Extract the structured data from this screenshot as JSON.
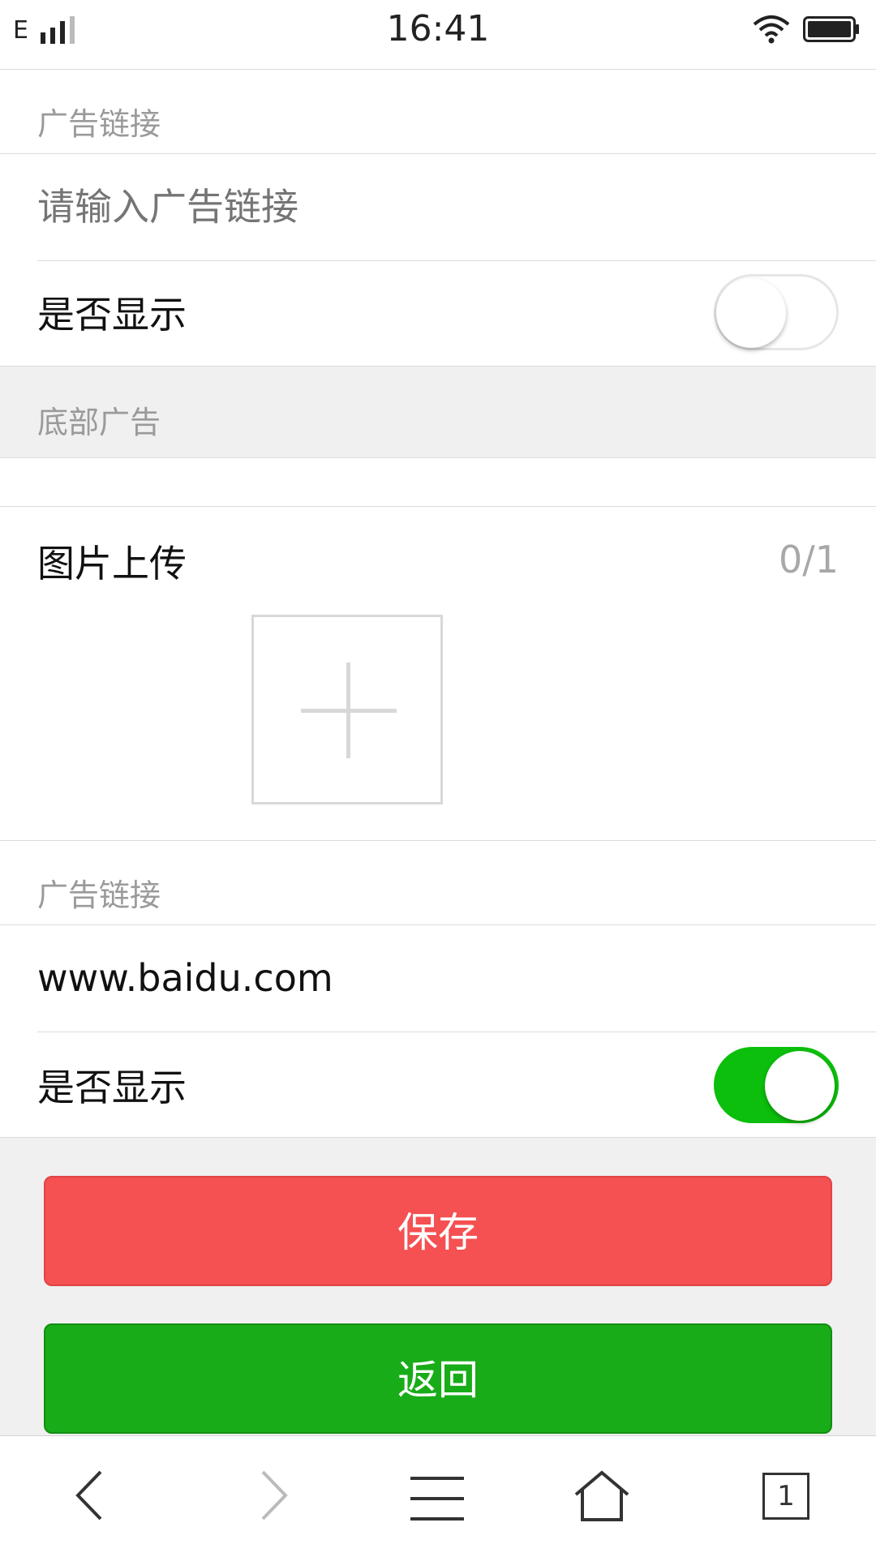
{
  "status_bar": {
    "carrier": "E",
    "time": "16:41"
  },
  "top_section": {
    "link_label": "广告链接",
    "link_input": {
      "value": "",
      "placeholder": "请输入广告链接"
    },
    "display_label": "是否显示",
    "display_enabled": false
  },
  "bottom_ad": {
    "section_title": "底部广告",
    "upload_label": "图片上传",
    "upload_count": "0/1",
    "link_label": "广告链接",
    "link_input": {
      "value": "www.baidu.com",
      "placeholder": ""
    },
    "display_label": "是否显示",
    "display_enabled": true
  },
  "buttons": {
    "save": "保存",
    "back": "返回"
  },
  "browser_nav": {
    "tab_count": "1"
  },
  "colors": {
    "save": "#f55052",
    "back": "#19ac19",
    "toggle_on": "#0cbf0c"
  },
  "icons": [
    "signal-icon",
    "wifi-icon",
    "battery-icon",
    "back-arrow-icon",
    "forward-arrow-icon",
    "menu-icon",
    "home-icon",
    "tabs-icon",
    "plus-icon"
  ]
}
